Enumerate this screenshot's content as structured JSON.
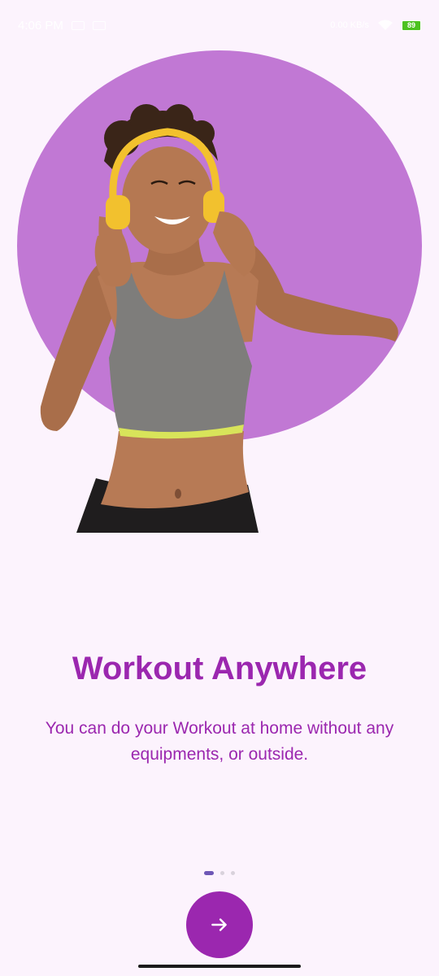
{
  "status_bar": {
    "time": "4:06 PM",
    "network": "0.00 KB/s",
    "battery_level": "89"
  },
  "onboarding": {
    "title": "Workout Anywhere",
    "description": "You can do your Workout at home without any equipments, or outside.",
    "page_count": 3,
    "current_page": 1
  },
  "colors": {
    "background": "#FCF3FD",
    "accent": "#9B27AF",
    "circle": "#C178D4",
    "indicator_active": "#6E57B6",
    "indicator_inactive": "#D9D2DC"
  },
  "icons": {
    "next": "arrow-right-icon"
  }
}
